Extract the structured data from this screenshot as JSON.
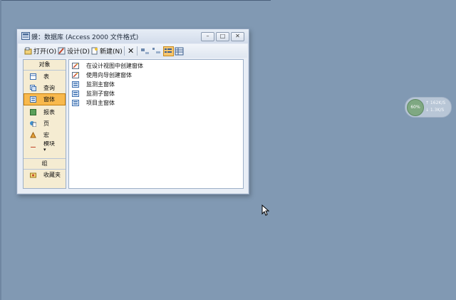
{
  "window": {
    "title": "鏝：数据库 (Access 2000 文件格式)",
    "minimize": "–",
    "maximize": "□",
    "close": "✕"
  },
  "toolbar": {
    "open": "打开(O)",
    "design": "设计(D)",
    "new": "新建(N)",
    "delete": "✕",
    "icons": [
      "large-icons-icon",
      "small-icons-icon",
      "list-view-icon",
      "details-view-icon"
    ]
  },
  "objects_panel": {
    "header": "对象",
    "items": [
      {
        "label": "表",
        "icon": "table-icon"
      },
      {
        "label": "查询",
        "icon": "query-icon"
      },
      {
        "label": "窗体",
        "icon": "form-icon",
        "selected": true
      },
      {
        "label": "报表",
        "icon": "report-icon"
      },
      {
        "label": "页",
        "icon": "page-icon"
      },
      {
        "label": "宏",
        "icon": "macro-icon"
      },
      {
        "label": "模块",
        "icon": "module-icon"
      }
    ],
    "more": "▾",
    "group_header": "组",
    "favorites": "收藏夹"
  },
  "forms_list": [
    {
      "label": "在设计视图中创建窗体",
      "icon": "wizard-icon"
    },
    {
      "label": "使用向导创建窗体",
      "icon": "wizard-icon"
    },
    {
      "label": "监测主窗体",
      "icon": "form-icon"
    },
    {
      "label": "监测子窗体",
      "icon": "form-icon"
    },
    {
      "label": "项目主窗体",
      "icon": "form-icon"
    }
  ],
  "net_monitor": {
    "percent": "60%",
    "upload": "↑ 162K/S",
    "download": "↓ 1.3K/S"
  },
  "colors": {
    "desktop": "#8199b3",
    "selected_bg": "#f8b94d",
    "panel_bg": "#f5ecd2"
  }
}
